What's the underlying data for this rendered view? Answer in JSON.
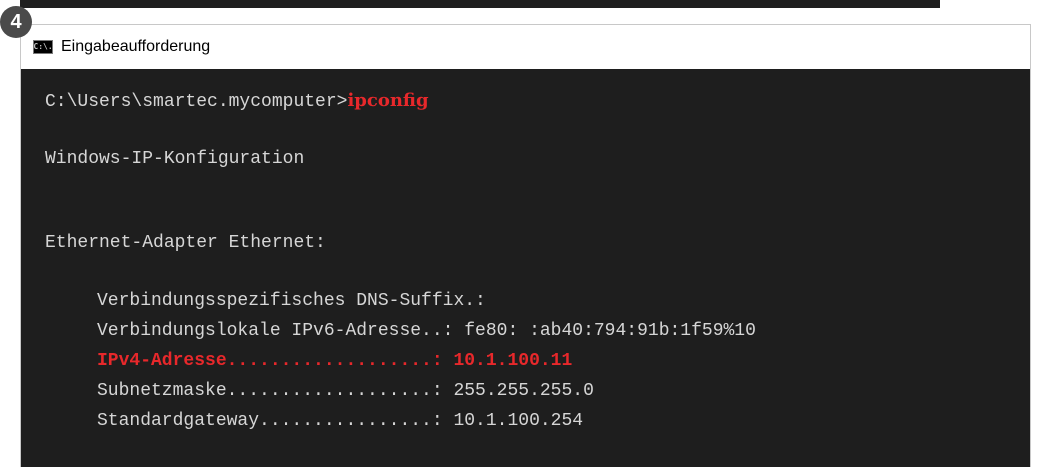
{
  "step_badge": "4",
  "window": {
    "title": "Eingabeaufforderung",
    "icon": "console-app-icon",
    "icon_text": "C:\\."
  },
  "console": {
    "prompt": "C:\\Users\\smartec.mycomputer>",
    "command": "ipconfig",
    "heading": "Windows-IP-Konfiguration",
    "adapter": "Ethernet-Adapter Ethernet:",
    "dns_suffix": "Verbindungsspezifisches DNS-Suffix.:",
    "ipv6": "Verbindungslokale IPv6-Adresse..: fe80: :ab40:794:91b:1f59%10",
    "ipv4": "IPv4-Adresse...................: 10.1.100.11",
    "subnet": "Subnetzmaske...................: 255.255.255.0",
    "gateway": "Standardgateway................: 10.1.100.254"
  },
  "colors": {
    "console_bg": "#1e1e1e",
    "console_text": "#d6d6d6",
    "highlight": "#e8282b"
  }
}
